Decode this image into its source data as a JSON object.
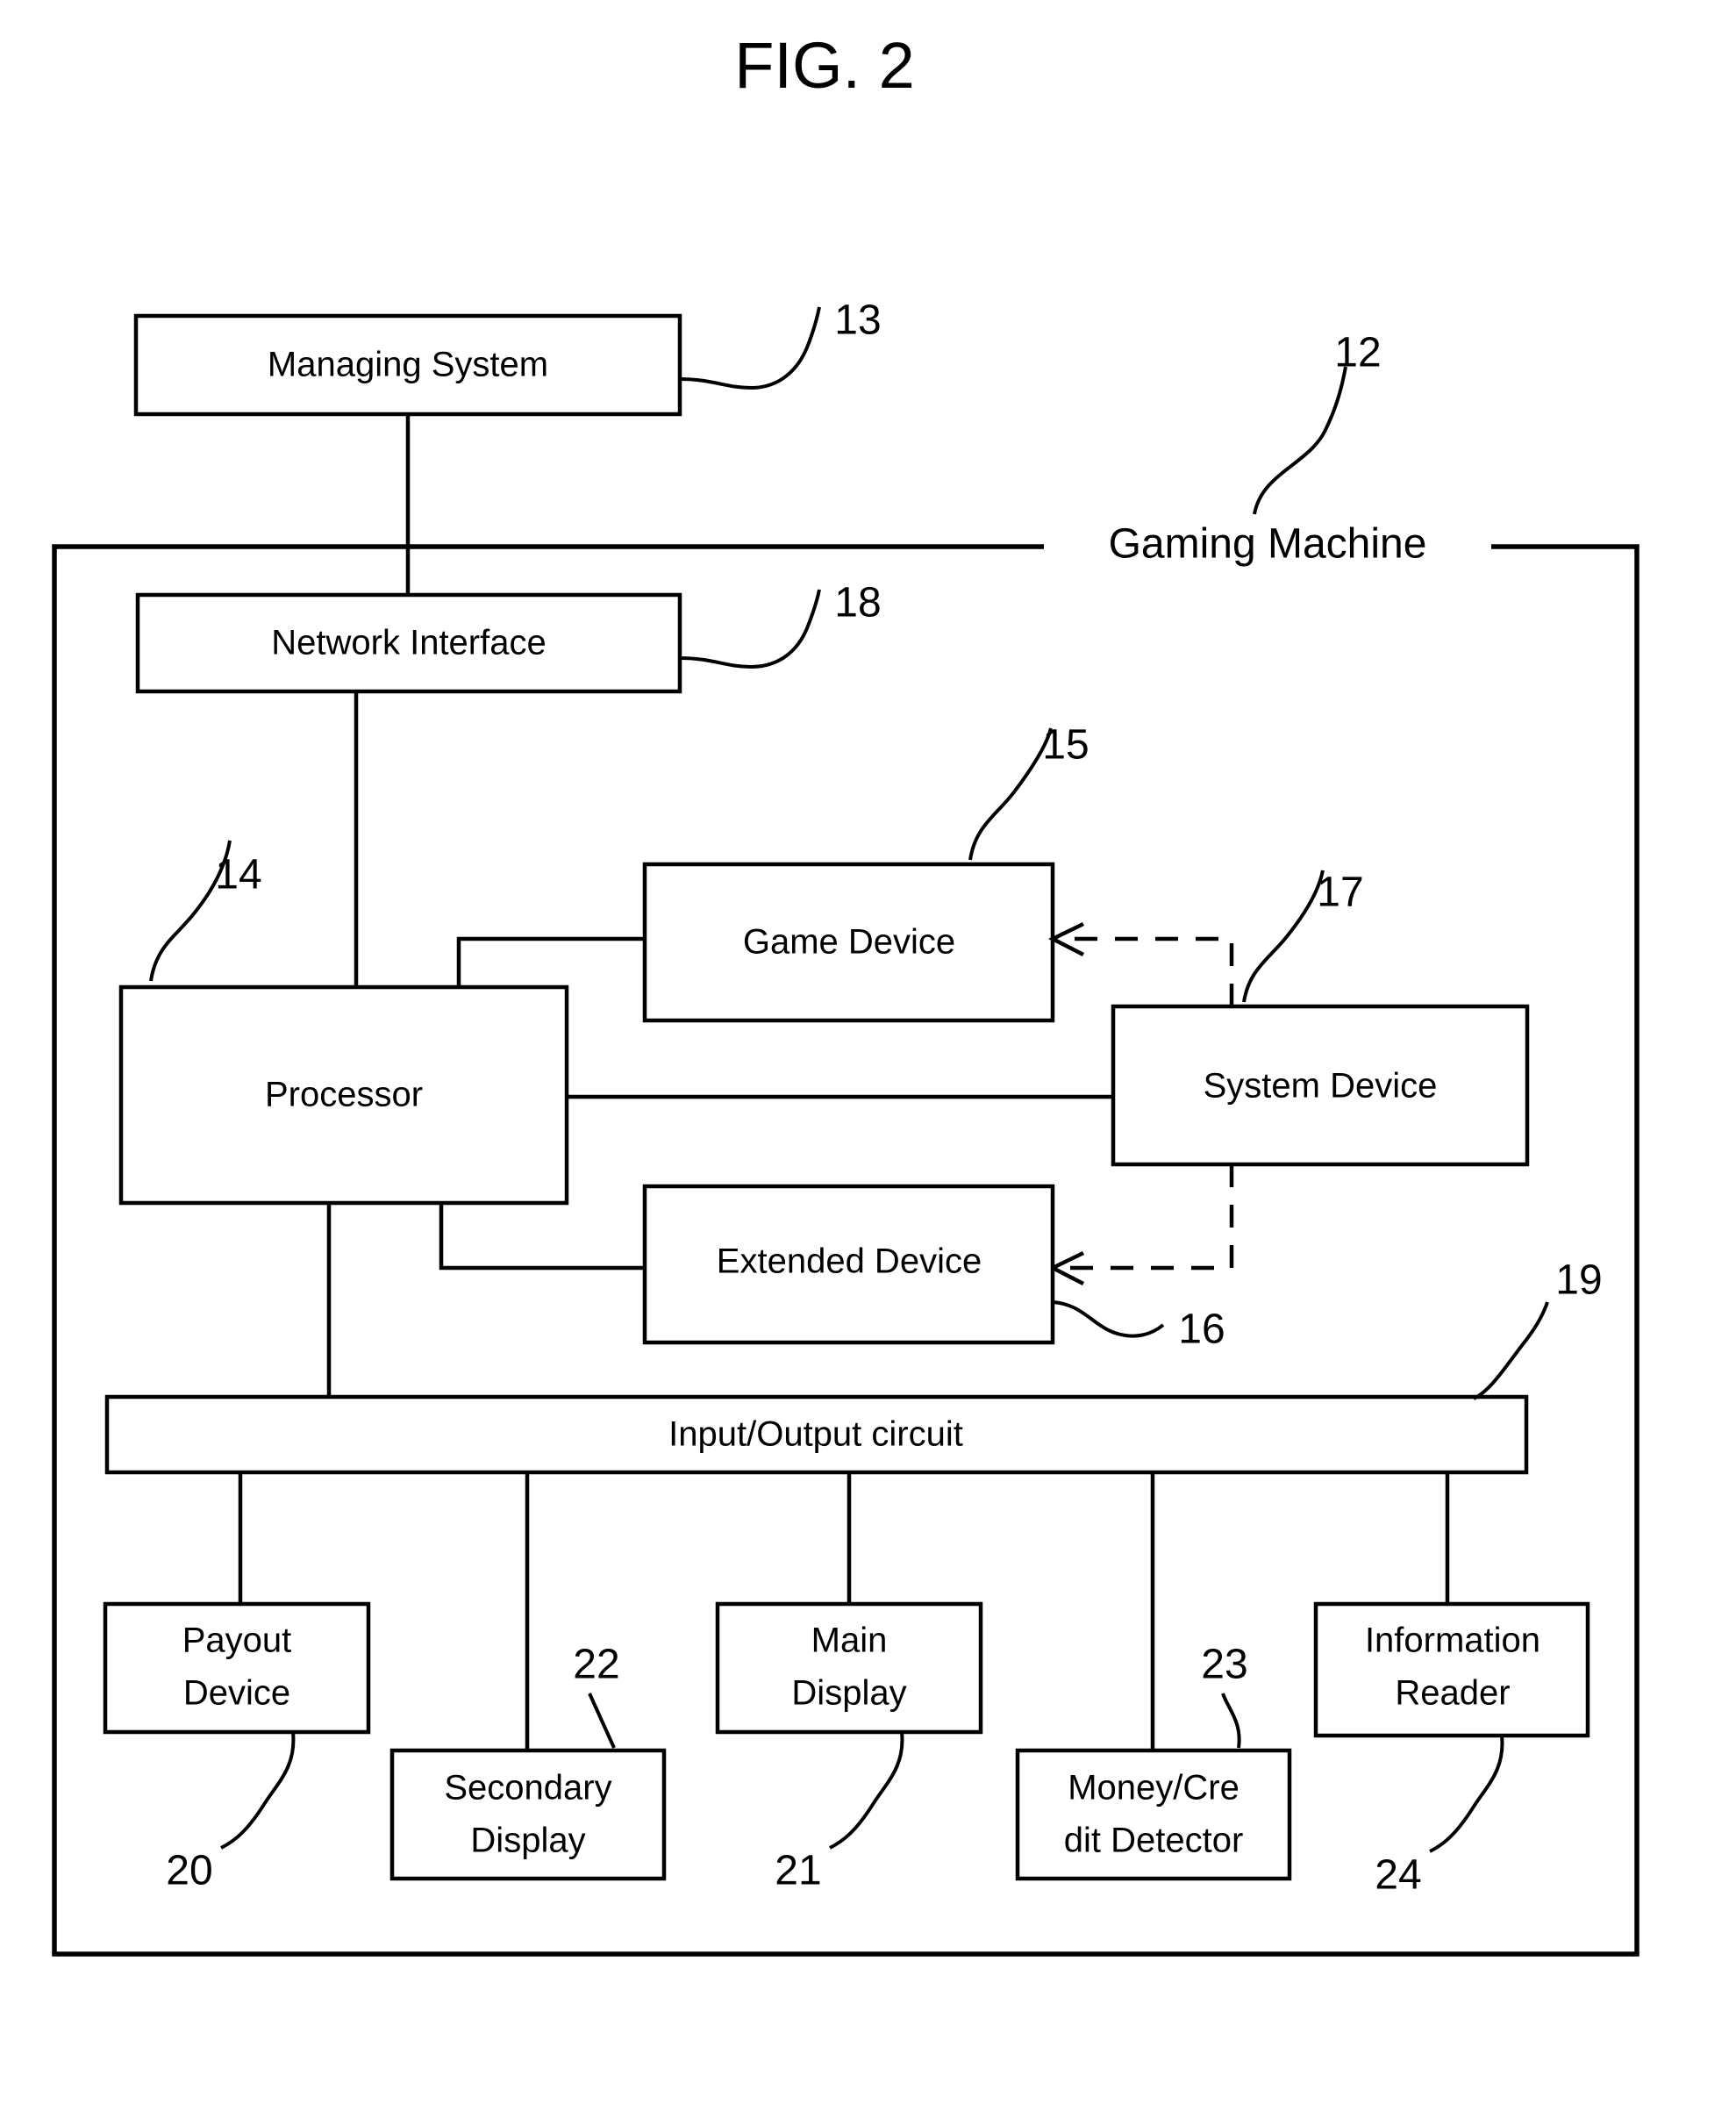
{
  "figure": {
    "title": "FIG. 2",
    "type": "patent-block-diagram",
    "subject": "Gaming Machine architecture"
  },
  "system_boundary": {
    "label": "Gaming Machine",
    "ref": "12"
  },
  "blocks": {
    "managing_system": {
      "label": "Managing System",
      "ref": "13"
    },
    "network_interface": {
      "label": "Network Interface",
      "ref": "18"
    },
    "processor": {
      "label": "Processor",
      "ref": "14"
    },
    "game_device": {
      "label": "Game Device",
      "ref": "15"
    },
    "system_device": {
      "label": "System Device",
      "ref": "17"
    },
    "extended_device": {
      "label": "Extended Device",
      "ref": "16"
    },
    "io_circuit": {
      "label": "Input/Output circuit",
      "ref": "19"
    },
    "payout_device": {
      "label_line1": "Payout",
      "label_line2": "Device",
      "ref": "20"
    },
    "secondary_display": {
      "label_line1": "Secondary",
      "label_line2": "Display",
      "ref": "22"
    },
    "main_display": {
      "label_line1": "Main",
      "label_line2": "Display",
      "ref": "21"
    },
    "money_credit_detector": {
      "label_line1": "Money/Cre",
      "label_line2": "dit Detector",
      "ref": "23"
    },
    "information_reader": {
      "label_line1": "Information",
      "label_line2": "Reader",
      "ref": "24"
    }
  },
  "connections": [
    {
      "from": "managing_system",
      "to": "network_interface",
      "style": "solid"
    },
    {
      "from": "network_interface",
      "to": "processor",
      "style": "solid"
    },
    {
      "from": "processor",
      "to": "game_device",
      "style": "solid"
    },
    {
      "from": "processor",
      "to": "system_device",
      "style": "solid"
    },
    {
      "from": "processor",
      "to": "extended_device",
      "style": "solid"
    },
    {
      "from": "processor",
      "to": "io_circuit",
      "style": "solid"
    },
    {
      "from": "system_device",
      "to": "game_device",
      "style": "dashed-arrow"
    },
    {
      "from": "system_device",
      "to": "extended_device",
      "style": "dashed-arrow"
    },
    {
      "from": "io_circuit",
      "to": "payout_device",
      "style": "solid"
    },
    {
      "from": "io_circuit",
      "to": "secondary_display",
      "style": "solid"
    },
    {
      "from": "io_circuit",
      "to": "main_display",
      "style": "solid"
    },
    {
      "from": "io_circuit",
      "to": "money_credit_detector",
      "style": "solid"
    },
    {
      "from": "io_circuit",
      "to": "information_reader",
      "style": "solid"
    }
  ],
  "colors": {
    "ink": "#000000",
    "paper": "#ffffff"
  }
}
